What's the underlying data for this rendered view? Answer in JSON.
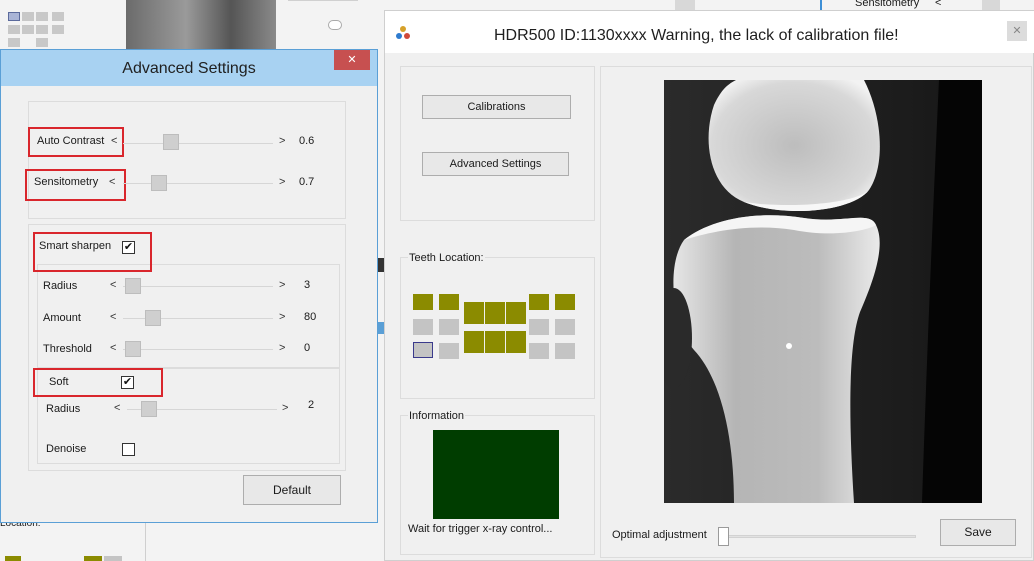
{
  "background_window": {
    "sensitometry_label": "Sensitometry",
    "sensitometry_arrow": "<",
    "location_label": "Location:"
  },
  "advanced_settings": {
    "title": "Advanced Settings",
    "close_glyph": "✕",
    "auto_contrast": {
      "label": "Auto Contrast",
      "left": "<",
      "right": ">",
      "value": "0.6"
    },
    "sensitometry": {
      "label": "Sensitometry",
      "left": "<",
      "right": ">",
      "value": "0.7"
    },
    "smart_sharpen": {
      "label": "Smart sharpen",
      "checked": "✔",
      "radius": {
        "label": "Radius",
        "left": "<",
        "right": ">",
        "value": "3"
      },
      "amount": {
        "label": "Amount",
        "left": "<",
        "right": ">",
        "value": "80"
      },
      "threshold": {
        "label": "Threshold",
        "left": "<",
        "right": ">",
        "value": "0"
      }
    },
    "soft": {
      "label": "Soft",
      "checked": "✔",
      "radius": {
        "label": "Radius",
        "left": "<",
        "right": ">",
        "value": "2"
      },
      "denoise": {
        "label": "Denoise",
        "checked": ""
      }
    },
    "default_button": "Default"
  },
  "hdr_window": {
    "title": "HDR500   ID:1130xxxx   Warning, the lack of calibration file!",
    "close_glyph": "✕",
    "calibrations_button": "Calibrations",
    "advanced_settings_button": "Advanced Settings",
    "teeth_location_label": "Teeth Location:",
    "information_label": "Information",
    "status_text": "Wait for trigger x-ray control...",
    "optimal_adjustment_label": "Optimal adjustment",
    "save_button": "Save",
    "colors": {
      "tooth_active": "#8b8b00",
      "tooth_inactive": "#c4c4c4",
      "info_screen": "#003d00"
    }
  }
}
